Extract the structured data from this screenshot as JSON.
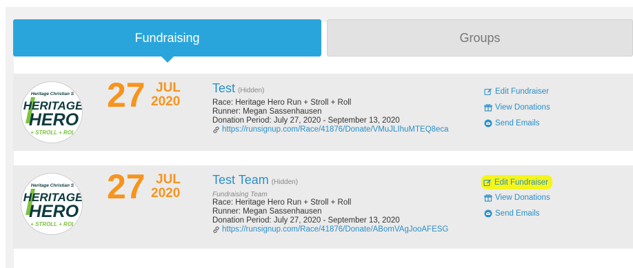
{
  "tabs": [
    {
      "label": "Fundraising",
      "active": true
    },
    {
      "label": "Groups",
      "active": false
    }
  ],
  "colors": {
    "accent": "#2aa5dc",
    "date": "#f7941d",
    "link": "#2a8fc9",
    "highlight": "#f6f51a",
    "logo_dark": "#0e3a3d",
    "logo_green": "#7cc242"
  },
  "logo": {
    "top_text": "Heritage Christian S",
    "line1": "HERITAGE",
    "line2": "HERO",
    "bottom_text": "+ STROLL + ROLL"
  },
  "fundraisers": [
    {
      "day": "27",
      "month": "JUL",
      "year": "2020",
      "title": "Test",
      "hidden_label": "(Hidden)",
      "subtype": "",
      "race": "Race: Heritage Hero Run + Stroll + Roll",
      "runner": "Runner: Megan Sassenhausen",
      "period": "Donation Period: July 27, 2020 - September 13, 2020",
      "url": "https://runsignup.com/Race/41876/Donate/VMuJLIhuMTEQ8eca",
      "actions": {
        "edit": "Edit Fundraiser",
        "donations": "View Donations",
        "emails": "Send Emails"
      }
    },
    {
      "day": "27",
      "month": "JUL",
      "year": "2020",
      "title": "Test Team",
      "hidden_label": "(Hidden)",
      "subtype": "Fundraising Team",
      "race": "Race: Heritage Hero Run + Stroll + Roll",
      "runner": "Runner: Megan Sassenhausen",
      "period": "Donation Period: July 27, 2020 - September 13, 2020",
      "url": "https://runsignup.com/Race/41876/Donate/ABomVAgJooAFESG",
      "actions": {
        "edit": "Edit Fundraiser",
        "donations": "View Donations",
        "emails": "Send Emails"
      }
    }
  ]
}
